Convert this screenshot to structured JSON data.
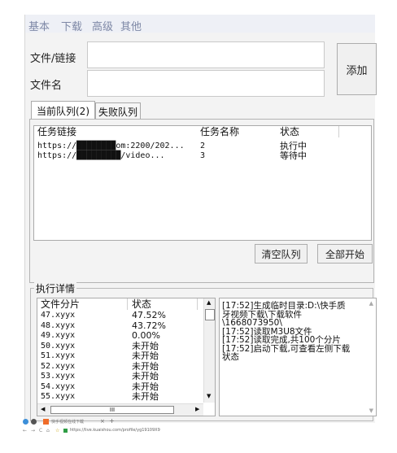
{
  "menu": [
    "基本",
    "下载",
    "高级",
    "其他"
  ],
  "form": {
    "file_link_label": "文件/链接",
    "file_name_label": "文件名",
    "add_button": "添加",
    "file_link_value": "",
    "file_name_value": ""
  },
  "tabs": [
    "当前队列(2)",
    "失败队列"
  ],
  "task_table": {
    "columns": [
      "任务链接",
      "任务名称",
      "状态"
    ],
    "rows": [
      {
        "link": "https://████████om:2200/202...",
        "name": "2",
        "status": "执行中"
      },
      {
        "link": "https://█████████/video...",
        "name": "3",
        "status": "等待中"
      }
    ]
  },
  "buttons": {
    "clear_queue": "清空队列",
    "start_all": "全部开始"
  },
  "details": {
    "title": "执行详情",
    "columns": [
      "文件分片",
      "状态"
    ],
    "rows": [
      {
        "file": "47.xyyx",
        "status": "47.52%"
      },
      {
        "file": "48.xyyx",
        "status": "43.72%"
      },
      {
        "file": "49.xyyx",
        "status": "0.00%"
      },
      {
        "file": "50.xyyx",
        "status": "未开始"
      },
      {
        "file": "51.xyyx",
        "status": "未开始"
      },
      {
        "file": "52.xyyx",
        "status": "未开始"
      },
      {
        "file": "53.xyyx",
        "status": "未开始"
      },
      {
        "file": "54.xyyx",
        "status": "未开始"
      },
      {
        "file": "55.xyyx",
        "status": "未开始"
      }
    ],
    "hscroll_grip": "III",
    "log": "[17:52]生成临时目录:D:\\快手质\n牙视频下载\\下载软件\n\\1668073950\\\n[17:52]读取M3U8文件\n[17:52]读取完成,共100个分片\n[17:52]启动下载,可查看左侧下载\n状态"
  },
  "taskbar": {
    "tab_title": "快手视频在线下载",
    "url": "https://live.kuaishou.com/profile/yg19109X9"
  }
}
